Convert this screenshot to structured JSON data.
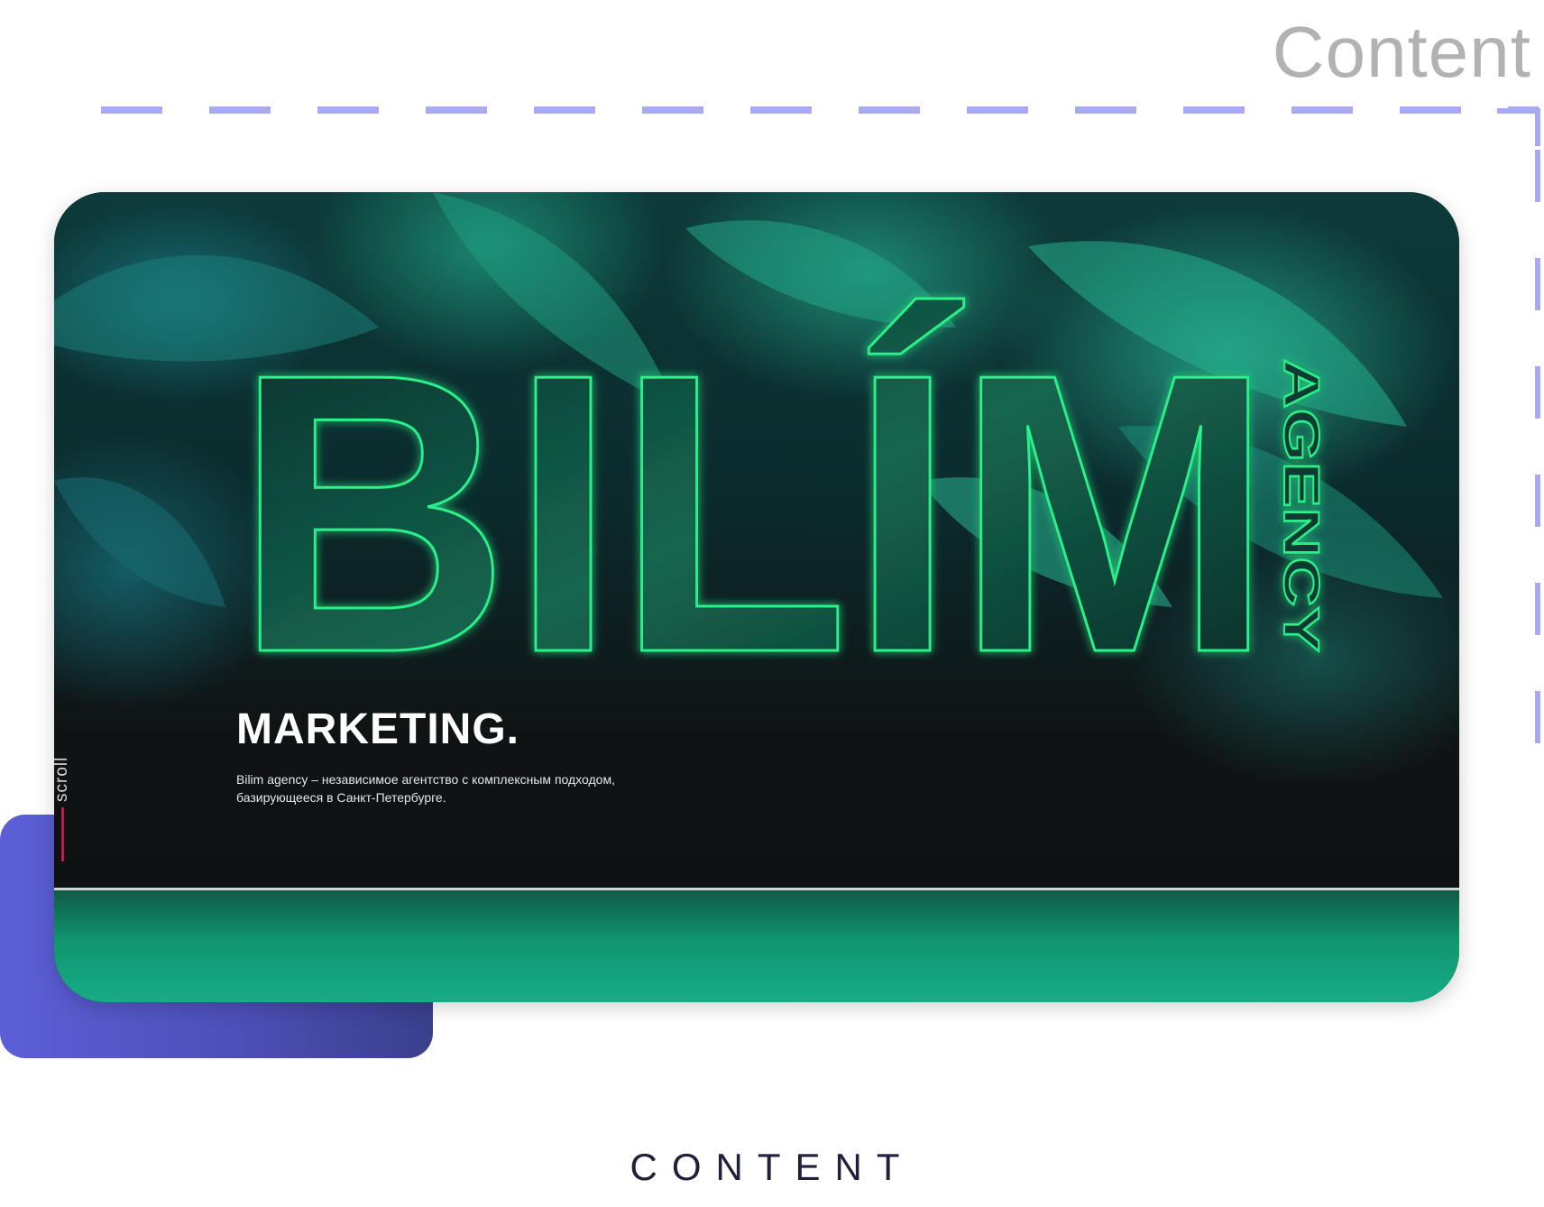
{
  "header": {
    "corner_label": "Content"
  },
  "hero": {
    "logo": {
      "word": "BILÍM",
      "side_word": "AGENCY"
    },
    "scroll_label": "scroll",
    "headline": "MARKETING.",
    "description": "Bilim agency – независимое агентство с комплексным подходом, базирующееся в Санкт-Петербурге."
  },
  "footer": {
    "caption": "CONTENT"
  },
  "colors": {
    "guide": "#a9a9ee",
    "neon_outline": "#2af08a",
    "accent_scroll": "#c2184a",
    "band": "#16ac86",
    "purple_block": "#5c5fd6"
  }
}
